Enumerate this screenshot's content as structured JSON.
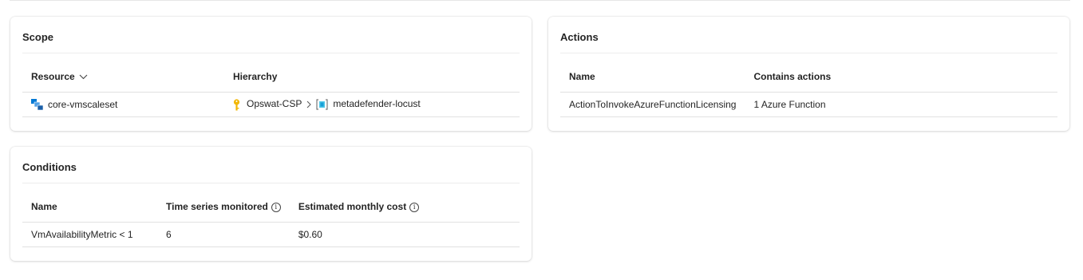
{
  "scope": {
    "title": "Scope",
    "columns": {
      "resource": "Resource",
      "hierarchy": "Hierarchy"
    },
    "row": {
      "resource_icon": "vm-scale-set-icon",
      "resource": "core-vmscaleset",
      "hierarchy": [
        {
          "icon": "key-icon",
          "label": "Opswat-CSP"
        },
        {
          "icon": "resource-group-icon",
          "label": "metadefender-locust"
        }
      ]
    }
  },
  "actions": {
    "title": "Actions",
    "columns": {
      "name": "Name",
      "contains": "Contains actions"
    },
    "row": {
      "name": "ActionToInvokeAzureFunctionLicensing",
      "contains": "1 Azure Function"
    }
  },
  "conditions": {
    "title": "Conditions",
    "columns": {
      "name": "Name",
      "time_series": "Time series monitored",
      "cost": "Estimated monthly cost"
    },
    "row": {
      "name": "VmAvailabilityMetric < 1",
      "time_series": "6",
      "cost": "$0.60"
    }
  },
  "colors": {
    "accent": "#0078d4",
    "key": "#f2b705",
    "border": "#e1e1e1"
  }
}
